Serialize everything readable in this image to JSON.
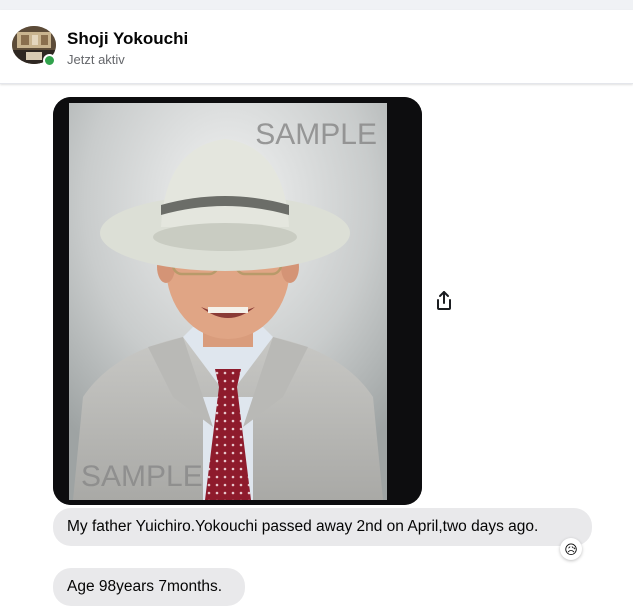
{
  "contact": {
    "name": "Shoji Yokouchi",
    "status": "Jetzt aktiv"
  },
  "photo": {
    "watermark_top": "SAMPLE",
    "watermark_bottom": "SAMPLE"
  },
  "messages": [
    {
      "text": "My father Yuichiro.Yokouchi passed away 2nd on April,two days ago.",
      "reaction": "😥"
    },
    {
      "text": "Age 98years 7months."
    }
  ],
  "colors": {
    "online": "#31a24c",
    "bubble": "#e9e9eb",
    "secondary_text": "#65676b"
  },
  "icons": {
    "share": "share-icon",
    "online": "online-status-dot"
  }
}
